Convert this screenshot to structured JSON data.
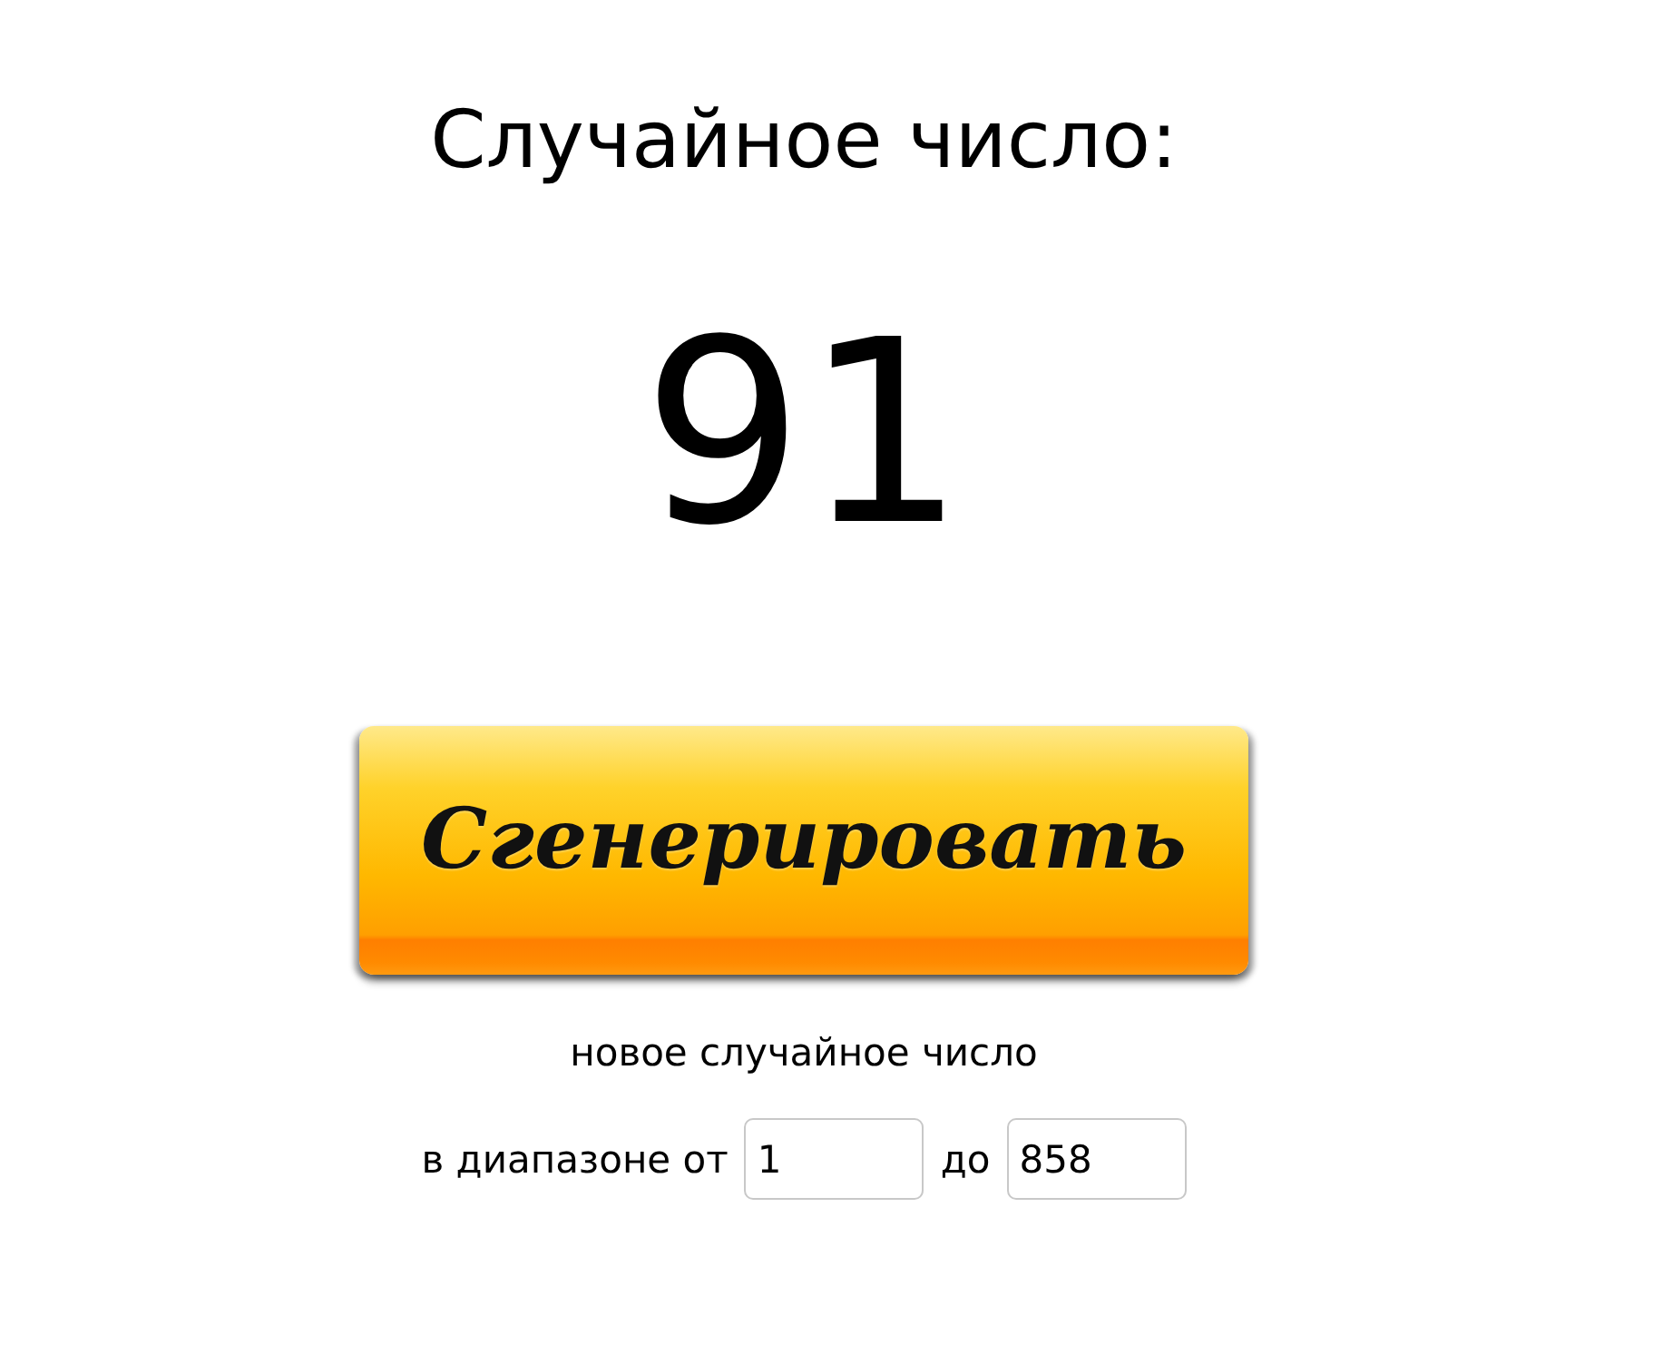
{
  "title": "Случайное число:",
  "number": "91",
  "generate_button": {
    "label": "Сгенерировать"
  },
  "caption": "новое случайное число",
  "range": {
    "from_label": "в диапазоне от",
    "from_value": "1",
    "to_label": "до",
    "to_value": "858"
  }
}
